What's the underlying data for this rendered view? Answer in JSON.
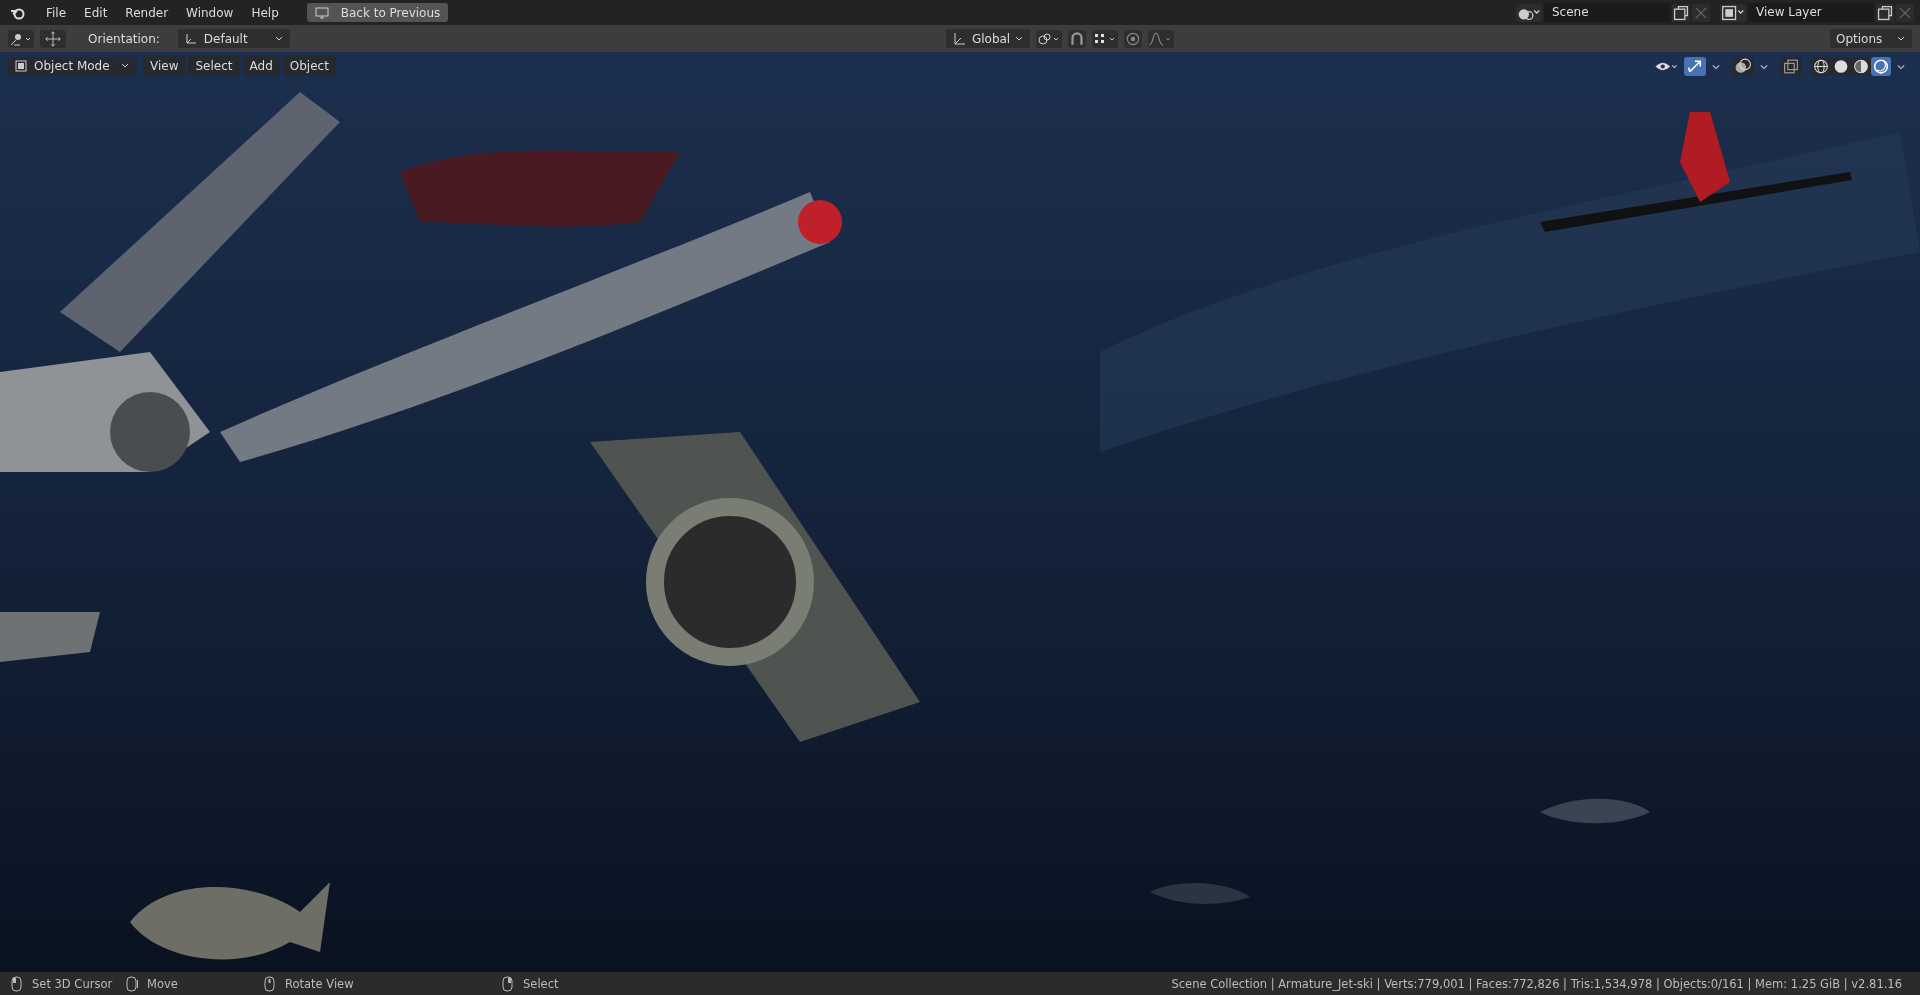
{
  "menu": [
    "File",
    "Edit",
    "Render",
    "Window",
    "Help"
  ],
  "back_button": "Back to Previous",
  "scene": "Scene",
  "view_layer": "View Layer",
  "tool_header": {
    "orientation_label": "Orientation:",
    "orientation": "Default",
    "transform": "Global",
    "options": "Options"
  },
  "viewport_header": {
    "mode": "Object Mode",
    "menus": [
      "View",
      "Select",
      "Add",
      "Object"
    ],
    "gizmo_on": true,
    "shading": [
      {
        "kind": "wireframe",
        "selected": false
      },
      {
        "kind": "solid",
        "selected": false
      },
      {
        "kind": "material",
        "selected": false
      },
      {
        "kind": "rendered",
        "selected": true
      }
    ]
  },
  "status_bar": {
    "hints": [
      {
        "kind": "left",
        "label": "Set 3D Cursor"
      },
      {
        "kind": "drag",
        "label": "Move"
      },
      {
        "kind": "middle",
        "label": "Rotate View"
      },
      {
        "kind": "right",
        "label": "Select"
      }
    ],
    "stats": "Scene Collection | Armature_Jet-ski | Verts:779,001 | Faces:772,826 | Tris:1,534,978 | Objects:0/161 | Mem: 1.25 GiB | v2.81.16"
  }
}
